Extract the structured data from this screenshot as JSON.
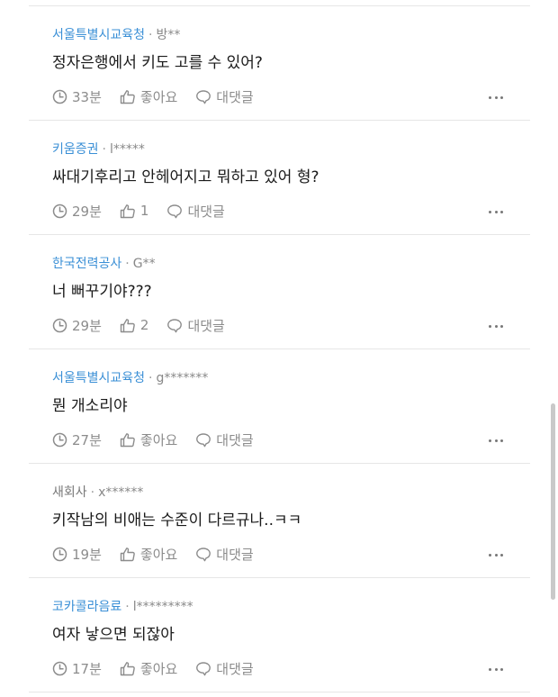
{
  "comments": [
    {
      "company": "서울특별시교육청",
      "company_linked": true,
      "user": "방**",
      "text": "정자은행에서 키도 고를 수 있어?",
      "time": "33분",
      "like": "좋아요",
      "reply": "대댓글"
    },
    {
      "company": "키움증권",
      "company_linked": true,
      "user": "l*****",
      "text": "싸대기후리고 안헤어지고 뭐하고 있어 형?",
      "time": "29분",
      "like": "1",
      "reply": "대댓글"
    },
    {
      "company": "한국전력공사",
      "company_linked": true,
      "user": "G**",
      "text": "너 뻐꾸기야???",
      "time": "29분",
      "like": "2",
      "reply": "대댓글"
    },
    {
      "company": "서울특별시교육청",
      "company_linked": true,
      "user": "g*******",
      "text": "뭔 개소리야",
      "time": "27분",
      "like": "좋아요",
      "reply": "대댓글"
    },
    {
      "company": "새회사",
      "company_linked": false,
      "user": "x******",
      "text": "키작남의 비애는 수준이 다르규나..ㅋㅋ",
      "time": "19분",
      "like": "좋아요",
      "reply": "대댓글"
    },
    {
      "company": "코카콜라음료",
      "company_linked": true,
      "user": "l*********",
      "text": "여자 낳으면 되잖아",
      "time": "17분",
      "like": "좋아요",
      "reply": "대댓글"
    }
  ],
  "separator": "·",
  "colors": {
    "company_link": "#3a8fd6",
    "muted": "#8c8c8c",
    "divider": "#e6e6e6"
  },
  "icons": {
    "time": "clock-icon",
    "like": "thumbs-up-icon",
    "reply": "speech-bubble-icon",
    "more": "more-options-icon"
  }
}
